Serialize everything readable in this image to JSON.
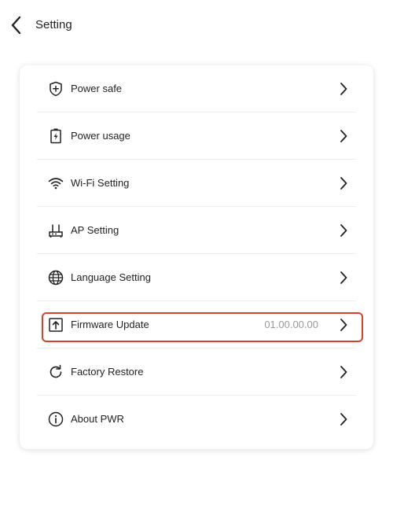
{
  "header": {
    "title": "Setting",
    "back_icon": "chevron-left-icon"
  },
  "settings": {
    "items": [
      {
        "label": "Power safe",
        "icon": "shield-plus-icon",
        "value": ""
      },
      {
        "label": "Power usage",
        "icon": "battery-charging-icon",
        "value": ""
      },
      {
        "label": "Wi-Fi Setting",
        "icon": "wifi-icon",
        "value": ""
      },
      {
        "label": "AP Setting",
        "icon": "router-icon",
        "value": ""
      },
      {
        "label": "Language Setting",
        "icon": "globe-icon",
        "value": ""
      },
      {
        "label": "Firmware Update",
        "icon": "upload-box-icon",
        "value": "01.00.00.00"
      },
      {
        "label": "Factory Restore",
        "icon": "refresh-icon",
        "value": ""
      },
      {
        "label": "About PWR",
        "icon": "info-icon",
        "value": ""
      }
    ]
  },
  "colors": {
    "highlight": "#d9402d",
    "value_text": "#9a9a9a"
  }
}
